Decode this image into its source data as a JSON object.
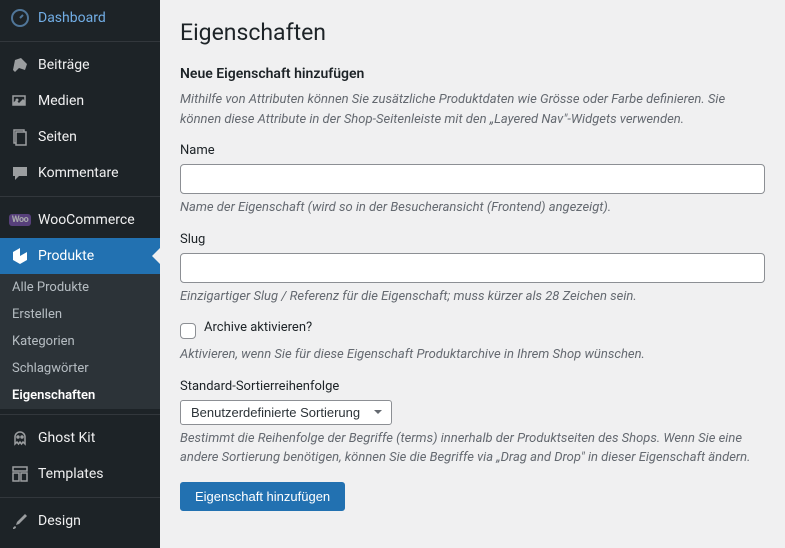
{
  "sidebar": {
    "items": [
      {
        "label": "Dashboard"
      },
      {
        "label": "Beiträge"
      },
      {
        "label": "Medien"
      },
      {
        "label": "Seiten"
      },
      {
        "label": "Kommentare"
      },
      {
        "label": "WooCommerce"
      },
      {
        "label": "Produkte"
      },
      {
        "label": "Ghost Kit"
      },
      {
        "label": "Templates"
      },
      {
        "label": "Design"
      }
    ],
    "submenu": [
      {
        "label": "Alle Produkte"
      },
      {
        "label": "Erstellen"
      },
      {
        "label": "Kategorien"
      },
      {
        "label": "Schlagwörter"
      },
      {
        "label": "Eigenschaften"
      }
    ]
  },
  "page": {
    "title": "Eigenschaften",
    "subheading": "Neue Eigenschaft hinzufügen",
    "intro": "Mithilfe von Attributen können Sie zusätzliche Produktdaten wie Grösse oder Farbe definieren. Sie können diese Attribute in der Shop-Seitenleiste mit den „Layered Nav\"-Widgets verwenden."
  },
  "fields": {
    "name_label": "Name",
    "name_help": "Name der Eigenschaft (wird so in der Besucheransicht (Frontend) angezeigt).",
    "slug_label": "Slug",
    "slug_help": "Einzigartiger Slug / Referenz für die Eigenschaft; muss kürzer als 28 Zeichen sein.",
    "archive_label": "Archive aktivieren?",
    "archive_help": "Aktivieren, wenn Sie für diese Eigenschaft Produktarchive in Ihrem Shop wünschen.",
    "sort_label": "Standard-Sortierreihenfolge",
    "sort_selected": "Benutzerdefinierte Sortierung",
    "sort_help": "Bestimmt die Reihenfolge der Begriffe (terms) innerhalb der Produktseiten des Shops. Wenn Sie eine andere Sortierung benötigen, können Sie die Begriffe via „Drag and Drop\" in dieser Eigenschaft ändern.",
    "submit_label": "Eigenschaft hinzufügen"
  }
}
